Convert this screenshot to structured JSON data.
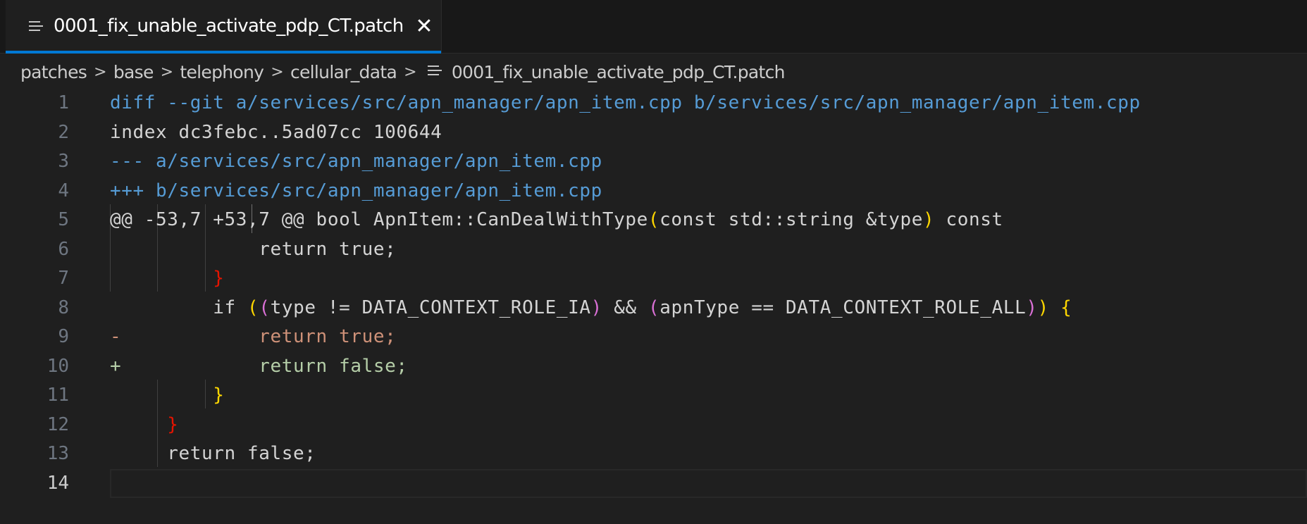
{
  "tab": {
    "title": "0001_fix_unable_activate_pdp_CT.patch",
    "icon": "file-lines-icon",
    "close_glyph": "✕"
  },
  "breadcrumb": {
    "items": [
      "patches",
      "base",
      "telephony",
      "cellular_data"
    ],
    "file": "0001_fix_unable_activate_pdp_CT.patch",
    "separator": ">"
  },
  "editor": {
    "active_line": 14,
    "lines": [
      {
        "n": "1",
        "segments": [
          {
            "t": "diff --git a/services/src/apn_manager/apn_item.cpp b/services/src/apn_manager/apn_item.cpp",
            "c": "c-blue"
          }
        ]
      },
      {
        "n": "2",
        "segments": [
          {
            "t": "index dc3febc..5ad07cc 100644",
            "c": "c-plain"
          }
        ]
      },
      {
        "n": "3",
        "segments": [
          {
            "t": "--- a/services/src/apn_manager/apn_item.cpp",
            "c": "c-blue"
          }
        ]
      },
      {
        "n": "4",
        "segments": [
          {
            "t": "+++ b/services/src/apn_manager/apn_item.cpp",
            "c": "c-blue"
          }
        ]
      },
      {
        "n": "5",
        "segments": [
          {
            "t": "@@ -53,7 +53,7 @@ bool ApnItem::CanDealWithType",
            "c": "c-plain"
          },
          {
            "t": "(",
            "c": "c-gold"
          },
          {
            "t": "const std::string &type",
            "c": "c-plain"
          },
          {
            "t": ")",
            "c": "c-gold"
          },
          {
            "t": " const",
            "c": "c-plain"
          }
        ]
      },
      {
        "n": "6",
        "segments": [
          {
            "t": "             return true;",
            "c": "c-plain"
          }
        ]
      },
      {
        "n": "7",
        "segments": [
          {
            "t": "         }",
            "c": "c-red"
          }
        ]
      },
      {
        "n": "8",
        "segments": [
          {
            "t": "         if ",
            "c": "c-plain"
          },
          {
            "t": "(",
            "c": "c-gold"
          },
          {
            "t": "(",
            "c": "c-pink"
          },
          {
            "t": "type != DATA_CONTEXT_ROLE_IA",
            "c": "c-plain"
          },
          {
            "t": ")",
            "c": "c-pink"
          },
          {
            "t": " && ",
            "c": "c-plain"
          },
          {
            "t": "(",
            "c": "c-pink"
          },
          {
            "t": "apnType == DATA_CONTEXT_ROLE_ALL",
            "c": "c-plain"
          },
          {
            "t": ")",
            "c": "c-pink"
          },
          {
            "t": ")",
            "c": "c-gold"
          },
          {
            "t": " ",
            "c": "c-plain"
          },
          {
            "t": "{",
            "c": "c-gold"
          }
        ]
      },
      {
        "n": "9",
        "segments": [
          {
            "t": "-            return true;",
            "c": "c-del"
          }
        ]
      },
      {
        "n": "10",
        "segments": [
          {
            "t": "+            return false;",
            "c": "c-add"
          }
        ]
      },
      {
        "n": "11",
        "segments": [
          {
            "t": "         }",
            "c": "c-gold"
          }
        ]
      },
      {
        "n": "12",
        "segments": [
          {
            "t": "     }",
            "c": "c-red"
          }
        ]
      },
      {
        "n": "13",
        "segments": [
          {
            "t": "     return false;",
            "c": "c-plain"
          }
        ]
      },
      {
        "n": "14",
        "segments": [
          {
            "t": "",
            "c": "c-plain"
          }
        ]
      }
    ]
  }
}
